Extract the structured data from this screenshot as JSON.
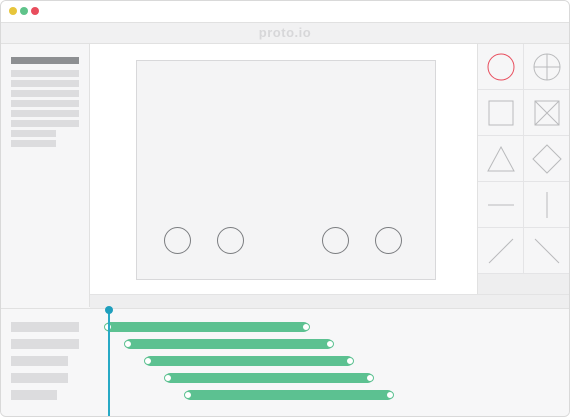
{
  "app": {
    "brand": "proto.io"
  },
  "colors": {
    "accent_playhead": "#27a9c5",
    "bar_green": "#5cc191",
    "dot_yellow": "#e7c53b",
    "dot_green": "#5fc38a",
    "dot_red": "#e84d5d",
    "selected_shape": "#e84d5d"
  },
  "window_controls": [
    {
      "name": "minimize",
      "color": "#e7c53b"
    },
    {
      "name": "maximize",
      "color": "#5fc38a"
    },
    {
      "name": "close",
      "color": "#e84d5d"
    }
  ],
  "shape_library": [
    {
      "icon": "circle-icon",
      "selected": true
    },
    {
      "icon": "circle-crosshair-icon",
      "selected": false
    },
    {
      "icon": "square-icon",
      "selected": false
    },
    {
      "icon": "square-cross-icon",
      "selected": false
    },
    {
      "icon": "triangle-icon",
      "selected": false
    },
    {
      "icon": "diamond-icon",
      "selected": false
    },
    {
      "icon": "horizontal-line-icon",
      "selected": false
    },
    {
      "icon": "vertical-line-icon",
      "selected": false
    },
    {
      "icon": "diagonal-line-up-icon",
      "selected": false
    },
    {
      "icon": "diagonal-line-down-icon",
      "selected": false
    }
  ],
  "artboard": {
    "circle_count": 4
  },
  "timeline": {
    "track_count": 5
  }
}
